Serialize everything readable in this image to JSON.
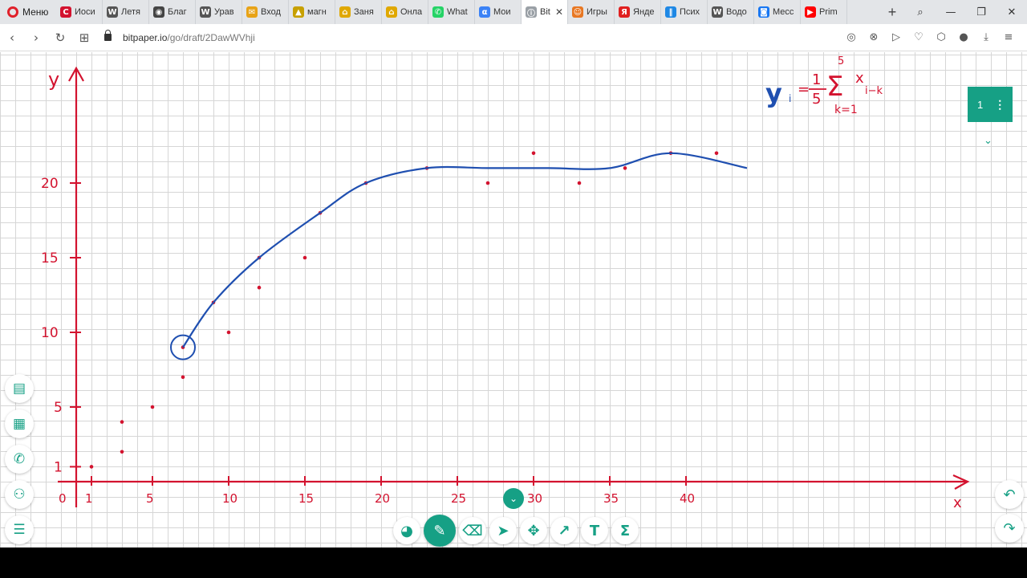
{
  "browser": {
    "menu_label": "Меню",
    "tabs": [
      {
        "title": "Иоси",
        "favicon_letter": "С",
        "favicon_color": "#d3132f"
      },
      {
        "title": "Летя",
        "favicon_letter": "W",
        "favicon_color": "#555555"
      },
      {
        "title": "Благ",
        "favicon_letter": "◉",
        "favicon_color": "#444444"
      },
      {
        "title": "Урав",
        "favicon_letter": "W",
        "favicon_color": "#555555"
      },
      {
        "title": "Вход",
        "favicon_letter": "✉",
        "favicon_color": "#e8a317"
      },
      {
        "title": "магн",
        "favicon_letter": "▲",
        "favicon_color": "#c7a000"
      },
      {
        "title": "Заня",
        "favicon_letter": "⌂",
        "favicon_color": "#e0a800"
      },
      {
        "title": "Онла",
        "favicon_letter": "⌂",
        "favicon_color": "#e0a800"
      },
      {
        "title": "What",
        "favicon_letter": "✆",
        "favicon_color": "#25d366"
      },
      {
        "title": "Мои",
        "favicon_letter": "α",
        "favicon_color": "#3b82f6"
      },
      {
        "title": "Bit",
        "favicon_letter": "ⓘ",
        "favicon_color": "#9aa0a6",
        "active": true
      },
      {
        "title": "Игры",
        "favicon_letter": "☺",
        "favicon_color": "#e87722"
      },
      {
        "title": "Янде",
        "favicon_letter": "Я",
        "favicon_color": "#e02020"
      },
      {
        "title": "Псих",
        "favicon_letter": "‖",
        "favicon_color": "#1e88e5"
      },
      {
        "title": "Водо",
        "favicon_letter": "W",
        "favicon_color": "#555555"
      },
      {
        "title": "Месс",
        "favicon_letter": "◙",
        "favicon_color": "#1877f2"
      },
      {
        "title": "Prim",
        "favicon_letter": "▶",
        "favicon_color": "#ff0000"
      }
    ],
    "url_host": "bitpaper.io",
    "url_path": "/go/draft/2DawWVhji"
  },
  "board": {
    "page_number": "1",
    "ink_color": "#d3132f",
    "curve_color": "#1f4fb0",
    "accent": "#16a085",
    "axis_x_label": "x",
    "axis_y_label": "y",
    "x_ticks": [
      "0",
      "1",
      "5",
      "10",
      "15",
      "20",
      "25",
      "30",
      "35",
      "40"
    ],
    "y_ticks": [
      "1",
      "5",
      "10",
      "15",
      "20"
    ],
    "formula": {
      "lhs": "y",
      "lhs_sub": "i",
      "eq": "=",
      "coef_num": "1",
      "coef_den": "5",
      "sigma": "Σ",
      "upper": "5",
      "lower": "k=1",
      "term": "x",
      "term_sub": "i−k"
    }
  },
  "chart_data": {
    "type": "scatter",
    "x_range": [
      0,
      44
    ],
    "y_range": [
      0,
      23
    ],
    "series": [
      {
        "kind": "points",
        "x": [
          1,
          3,
          3,
          5,
          7,
          7,
          9,
          10,
          12,
          12,
          15,
          16,
          19,
          23,
          27,
          30,
          33,
          36,
          39,
          42
        ],
        "y": [
          1,
          2,
          4,
          5,
          7,
          9,
          12,
          10,
          13,
          15,
          15,
          18,
          20,
          21,
          20,
          22,
          20,
          21,
          22,
          22
        ]
      },
      {
        "kind": "smoothed-curve",
        "x": [
          7,
          9,
          12,
          16,
          19,
          23,
          27,
          31,
          35,
          39,
          44
        ],
        "y": [
          9,
          12,
          15,
          18,
          20,
          21,
          21,
          21,
          21,
          22,
          21
        ]
      }
    ]
  }
}
